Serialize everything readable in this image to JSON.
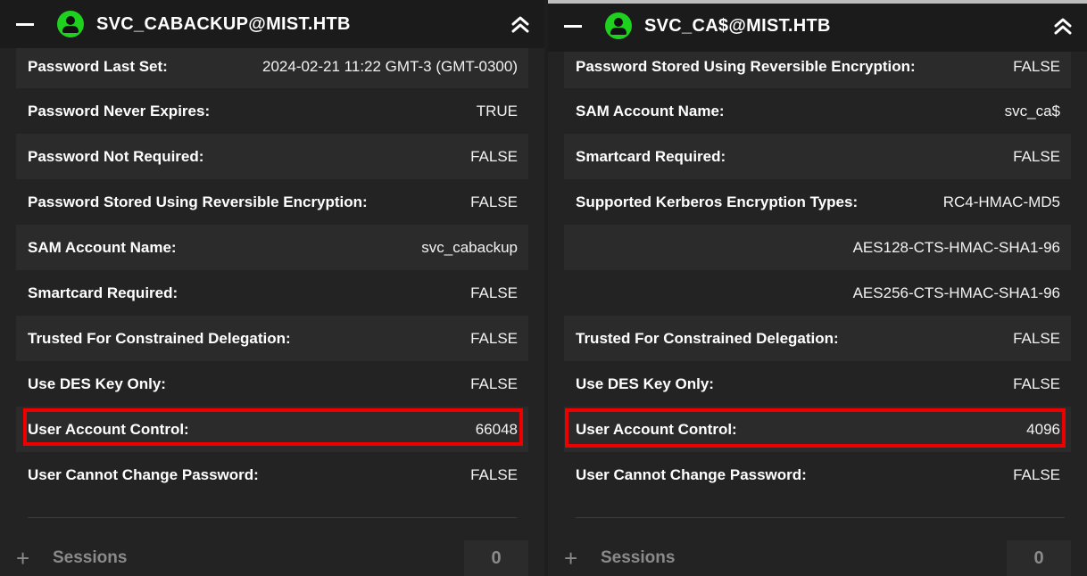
{
  "left": {
    "title": "SVC_CABACKUP@MIST.HTB",
    "rows": [
      {
        "label": "Password Last Set:",
        "value": "2024-02-21 11:22 GMT-3 (GMT-0300)"
      },
      {
        "label": "Password Never Expires:",
        "value": "TRUE"
      },
      {
        "label": "Password Not Required:",
        "value": "FALSE"
      },
      {
        "label": "Password Stored Using Reversible Encryption:",
        "value": "FALSE"
      },
      {
        "label": "SAM Account Name:",
        "value": "svc_cabackup"
      },
      {
        "label": "Smartcard Required:",
        "value": "FALSE"
      },
      {
        "label": "Trusted For Constrained Delegation:",
        "value": "FALSE"
      },
      {
        "label": "Use DES Key Only:",
        "value": "FALSE"
      },
      {
        "label": "User Account Control:",
        "value": "66048"
      },
      {
        "label": "User Cannot Change Password:",
        "value": "FALSE"
      }
    ],
    "sessions_label": "Sessions",
    "sessions_count": "0"
  },
  "right": {
    "title": "SVC_CA$@MIST.HTB",
    "rows": [
      {
        "label": "Password Stored Using Reversible Encryption:",
        "value": "FALSE"
      },
      {
        "label": "SAM Account Name:",
        "value": "svc_ca$"
      },
      {
        "label": "Smartcard Required:",
        "value": "FALSE"
      },
      {
        "label": "Supported Kerberos Encryption Types:",
        "value": "RC4-HMAC-MD5"
      },
      {
        "label": "",
        "value": "AES128-CTS-HMAC-SHA1-96"
      },
      {
        "label": "",
        "value": "AES256-CTS-HMAC-SHA1-96"
      },
      {
        "label": "Trusted For Constrained Delegation:",
        "value": "FALSE"
      },
      {
        "label": "Use DES Key Only:",
        "value": "FALSE"
      },
      {
        "label": "User Account Control:",
        "value": "4096"
      },
      {
        "label": "User Cannot Change Password:",
        "value": "FALSE"
      }
    ],
    "sessions_label": "Sessions",
    "sessions_count": "0"
  },
  "icons": {
    "minimize": "minimize-icon",
    "avatar": "user-icon",
    "collapse": "double-chevron-up-icon",
    "expand": "plus-icon"
  },
  "colors": {
    "avatar": "#1fd11f",
    "highlight": "#ee0000"
  }
}
